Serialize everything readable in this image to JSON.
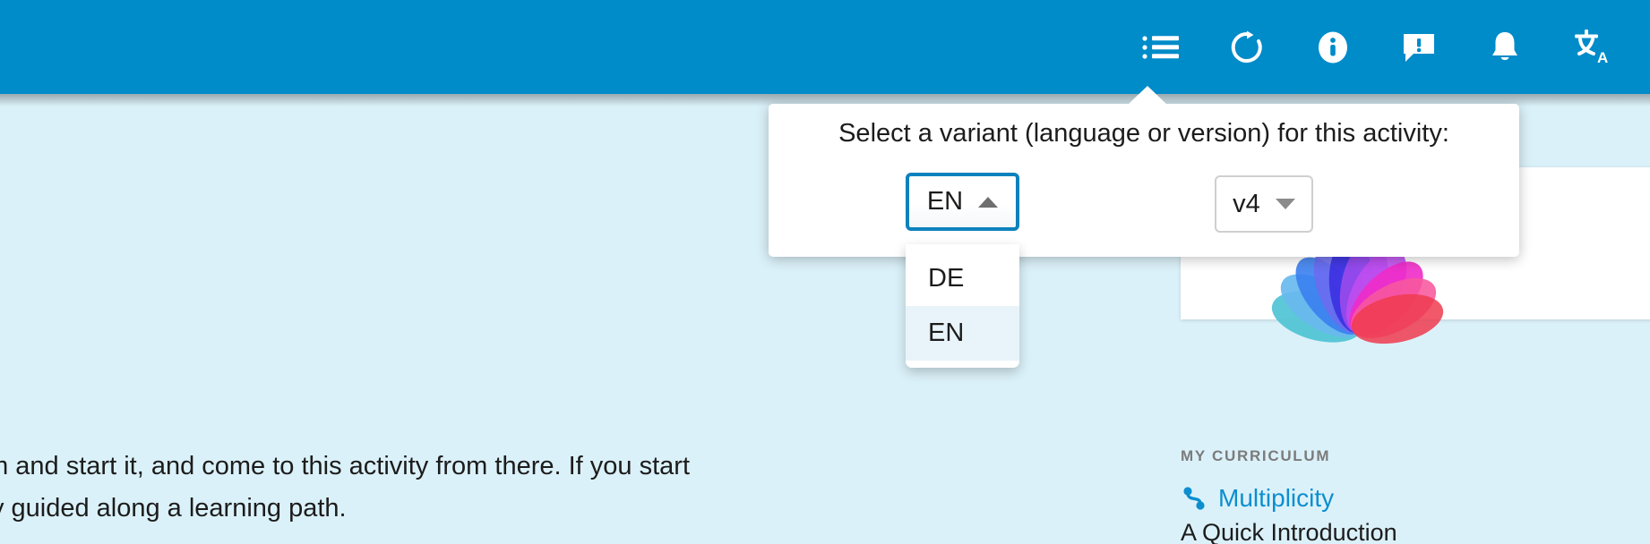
{
  "theme": {
    "header_blue": "#008bc9",
    "page_bg": "#dbf1f9",
    "focus_blue": "#0d81bd",
    "link_blue": "#0d8ecf",
    "highlight_bg": "#e8f4fa",
    "label_gray": "#7b7b7b"
  },
  "appbar": {
    "tools": [
      {
        "name": "list-icon",
        "label": "Table of contents"
      },
      {
        "name": "refresh-icon",
        "label": "Reload"
      },
      {
        "name": "info-icon",
        "label": "Information"
      },
      {
        "name": "feedback-icon",
        "label": "Feedback"
      },
      {
        "name": "bell-icon",
        "label": "Notifications"
      },
      {
        "name": "translate-icon",
        "label": "Language"
      }
    ]
  },
  "popover": {
    "title": "Select a variant (language or version) for this activity:",
    "language_select": {
      "value": "EN",
      "state": "open",
      "caret": "up",
      "options": [
        {
          "label": "DE",
          "selected": false
        },
        {
          "label": "EN",
          "selected": true
        }
      ]
    },
    "version_select": {
      "value": "v4",
      "state": "closed",
      "caret": "down"
    }
  },
  "main": {
    "paragraph_line1": "urriculum and start it, and come to this activity from there. If you start",
    "paragraph_line2": "be nicely guided along a learning path."
  },
  "curriculum": {
    "label": "MY CURRICULUM",
    "link": "Multiplicity",
    "subtitle": "A Quick Introduction",
    "icon": "curriculum-path-icon"
  }
}
